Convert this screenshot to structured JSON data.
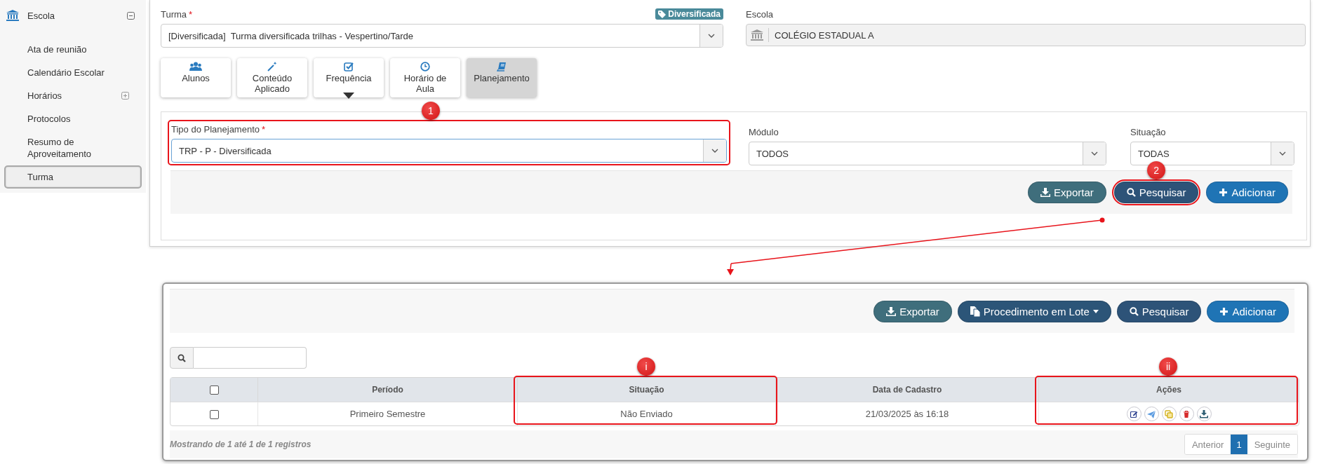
{
  "sidebar": {
    "group": {
      "label": "Escola",
      "expanded": true
    },
    "items": [
      {
        "label": "Ata de reunião",
        "selected": false,
        "expandable": false
      },
      {
        "label": "Calendário Escolar",
        "selected": false,
        "expandable": false
      },
      {
        "label": "Horários",
        "selected": false,
        "expandable": true
      },
      {
        "label": "Protocolos",
        "selected": false,
        "expandable": false
      },
      {
        "label": "Resumo de Aproveitamento",
        "selected": false,
        "expandable": false
      },
      {
        "label": "Turma",
        "selected": true,
        "expandable": false
      }
    ]
  },
  "turma": {
    "label": "Turma",
    "required_mark": "*",
    "badge": "Diversificada",
    "value": "[Diversificada]  Turma diversificada trilhas - Vespertino/Tarde"
  },
  "escola": {
    "label": "Escola",
    "value": "COLÉGIO ESTADUAL A"
  },
  "tabs": [
    {
      "label": "Alunos",
      "selected": false,
      "has_menu": false
    },
    {
      "label": "Conteúdo Aplicado",
      "selected": false,
      "has_menu": false
    },
    {
      "label": "Frequência",
      "selected": false,
      "has_menu": true
    },
    {
      "label": "Horário de Aula",
      "selected": false,
      "has_menu": false
    },
    {
      "label": "Planejamento",
      "selected": true,
      "has_menu": false
    }
  ],
  "filters": [
    {
      "label": "Tipo do Planejamento",
      "required_mark": "*",
      "value": "TRP - P - Diversificada",
      "annotation": "1"
    },
    {
      "label": "Módulo",
      "value": "TODOS"
    },
    {
      "label": "Situação",
      "value": "TODAS"
    }
  ],
  "filter_buttons": [
    {
      "label": "Exportar",
      "kind": "export"
    },
    {
      "label": "Pesquisar",
      "kind": "search",
      "annotation": "2"
    },
    {
      "label": "Adicionar",
      "kind": "add"
    }
  ],
  "results": {
    "buttons": [
      {
        "label": "Exportar",
        "kind": "export"
      },
      {
        "label": "Procedimento em Lote",
        "kind": "batch",
        "has_menu": true
      },
      {
        "label": "Pesquisar",
        "kind": "search"
      },
      {
        "label": "Adicionar",
        "kind": "add"
      }
    ],
    "table": {
      "header_checked": false,
      "columns": [
        {
          "label": "Período"
        },
        {
          "label": "Situação",
          "annotation": "i"
        },
        {
          "label": "Data de Cadastro"
        },
        {
          "label": "Ações",
          "annotation": "ii"
        }
      ],
      "rows": [
        {
          "selected": false,
          "cells": [
            "Primeiro Semestre",
            "Não Enviado",
            "21/03/2025 às 16:18"
          ]
        }
      ]
    },
    "footer": "Mostrando de 1 até 1 de 1 registros",
    "pagination": {
      "previous": "Anterior",
      "pages": [
        {
          "label": "1",
          "selected": true
        }
      ],
      "next": "Seguinte"
    }
  }
}
